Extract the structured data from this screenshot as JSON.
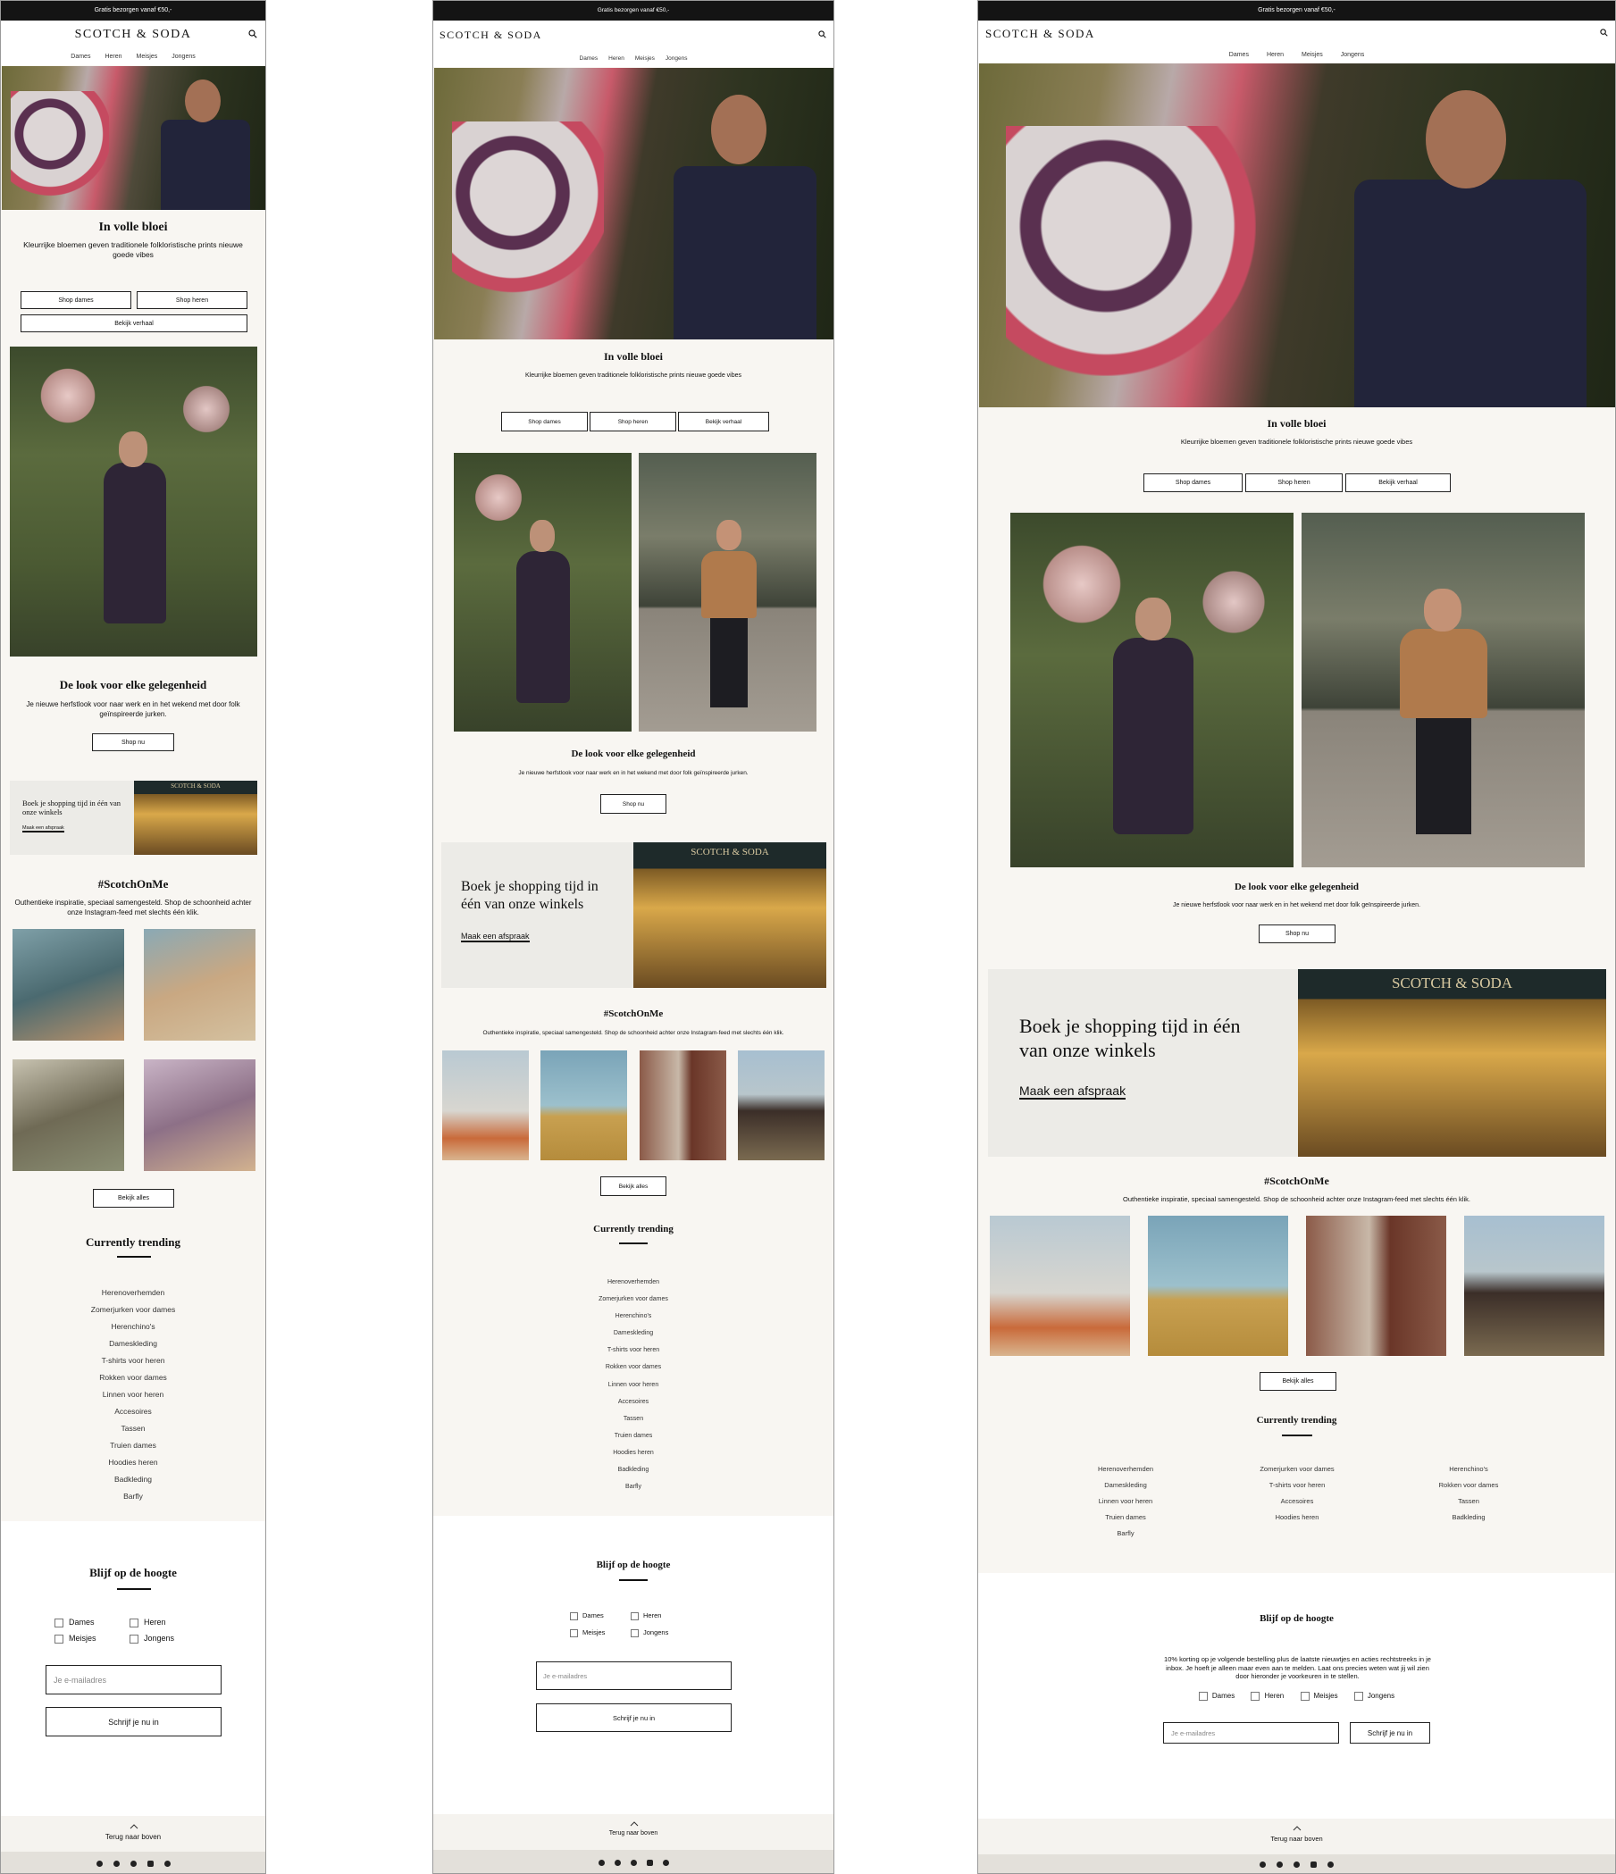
{
  "brand": "SCOTCH & SODA",
  "topbar": "Gratis bezorgen vanaf €50,-",
  "nav": [
    "Dames",
    "Heren",
    "Meisjes",
    "Jongens"
  ],
  "hero": {
    "title": "In volle bloei",
    "subtitle": "Kleurrijke bloemen geven traditionele folkloristische prints nieuwe goede vibes",
    "btn_women": "Shop dames",
    "btn_men": "Shop heren",
    "btn_story": "Bekijk verhaal"
  },
  "look": {
    "title": "De look voor elke gelegenheid",
    "subtitle": "Je nieuwe herfstlook voor naar werk en in het wekend met door folk geïnspireerde jurken.",
    "btn": "Shop nu"
  },
  "store": {
    "title": "Boek je shopping tijd in één van onze winkels",
    "link": "Maak een afspraak",
    "sign": "SCOTCH & SODA"
  },
  "insta": {
    "title": "#ScotchOnMe",
    "subtitle": "Outhentieke inspiratie, speciaal samengesteld. Shop de schoonheid achter onze Instagram-feed met slechts één klik.",
    "btn": "Bekijk alles"
  },
  "trending": {
    "title": "Currently trending",
    "items": [
      "Herenoverhemden",
      "Zomerjurken voor dames",
      "Herenchino's",
      "Dameskleding",
      "T-shirts voor heren",
      "Rokken voor dames",
      "Linnen voor heren",
      "Accesoires",
      "Tassen",
      "Truien dames",
      "Hoodies heren",
      "Badkleding",
      "Barfly"
    ]
  },
  "newsletter": {
    "title": "Blijf op de hoogte",
    "text": "10% korting op je volgende bestelling plus de laatste nieuwtjes en acties rechtstreeks in je inbox. Je hoeft je alleen maar even aan te melden. Laat ons precies weten wat jij wil zien door hieronder je voorkeuren in te stellen.",
    "options": [
      "Dames",
      "Heren",
      "Meisjes",
      "Jongens"
    ],
    "placeholder": "Je e-mailadres",
    "submit": "Schrijf je nu in"
  },
  "footer": {
    "back_to_top": "Terug naar boven"
  },
  "social_icons": [
    "facebook-icon",
    "instagram-icon",
    "pinterest-icon",
    "youtube-icon",
    "twitter-icon"
  ],
  "colors": {
    "page_bg": "#f8f6f2",
    "topbar": "#141414",
    "store_panel": "#ecebe7",
    "social_bar": "#e3e0da"
  }
}
